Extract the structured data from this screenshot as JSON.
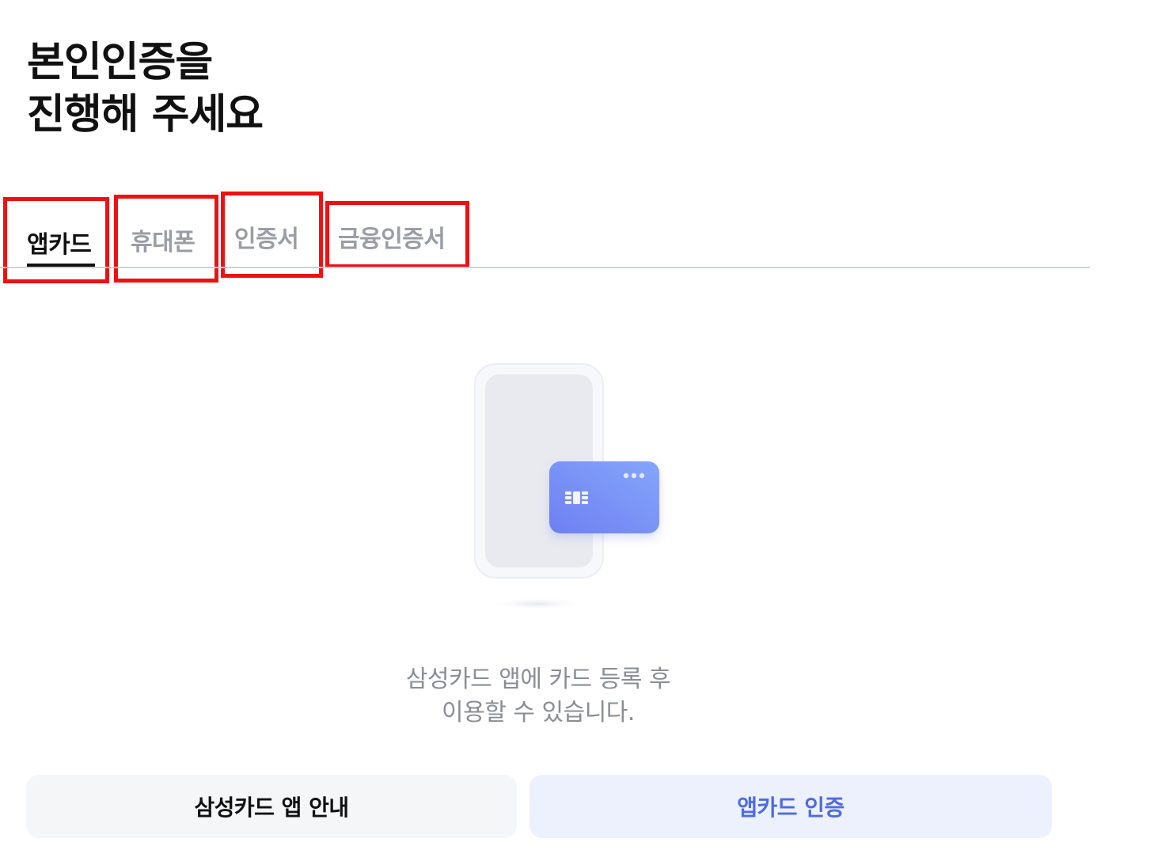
{
  "header": {
    "title_line1": "본인인증을",
    "title_line2": "진행해 주세요"
  },
  "tabs": [
    {
      "label": "앱카드",
      "active": true
    },
    {
      "label": "휴대폰",
      "active": false
    },
    {
      "label": "인증서",
      "active": false
    },
    {
      "label": "금융인증서",
      "active": false
    }
  ],
  "illustration": {
    "icons": [
      "phone-icon",
      "card-icon",
      "card-chip-icon"
    ],
    "card_gradient": [
      "#6f7ff2",
      "#84a6fb"
    ]
  },
  "notice": {
    "line1": "삼성카드 앱에 카드 등록 후",
    "line2": "이용할 수 있습니다."
  },
  "actions": {
    "guide_label": "삼성카드 앱 안내",
    "auth_label": "앱카드 인증"
  },
  "colors": {
    "accent": "#4f6be0",
    "highlight_box": "#ee1111",
    "inactive_tab": "#9a9da3"
  }
}
